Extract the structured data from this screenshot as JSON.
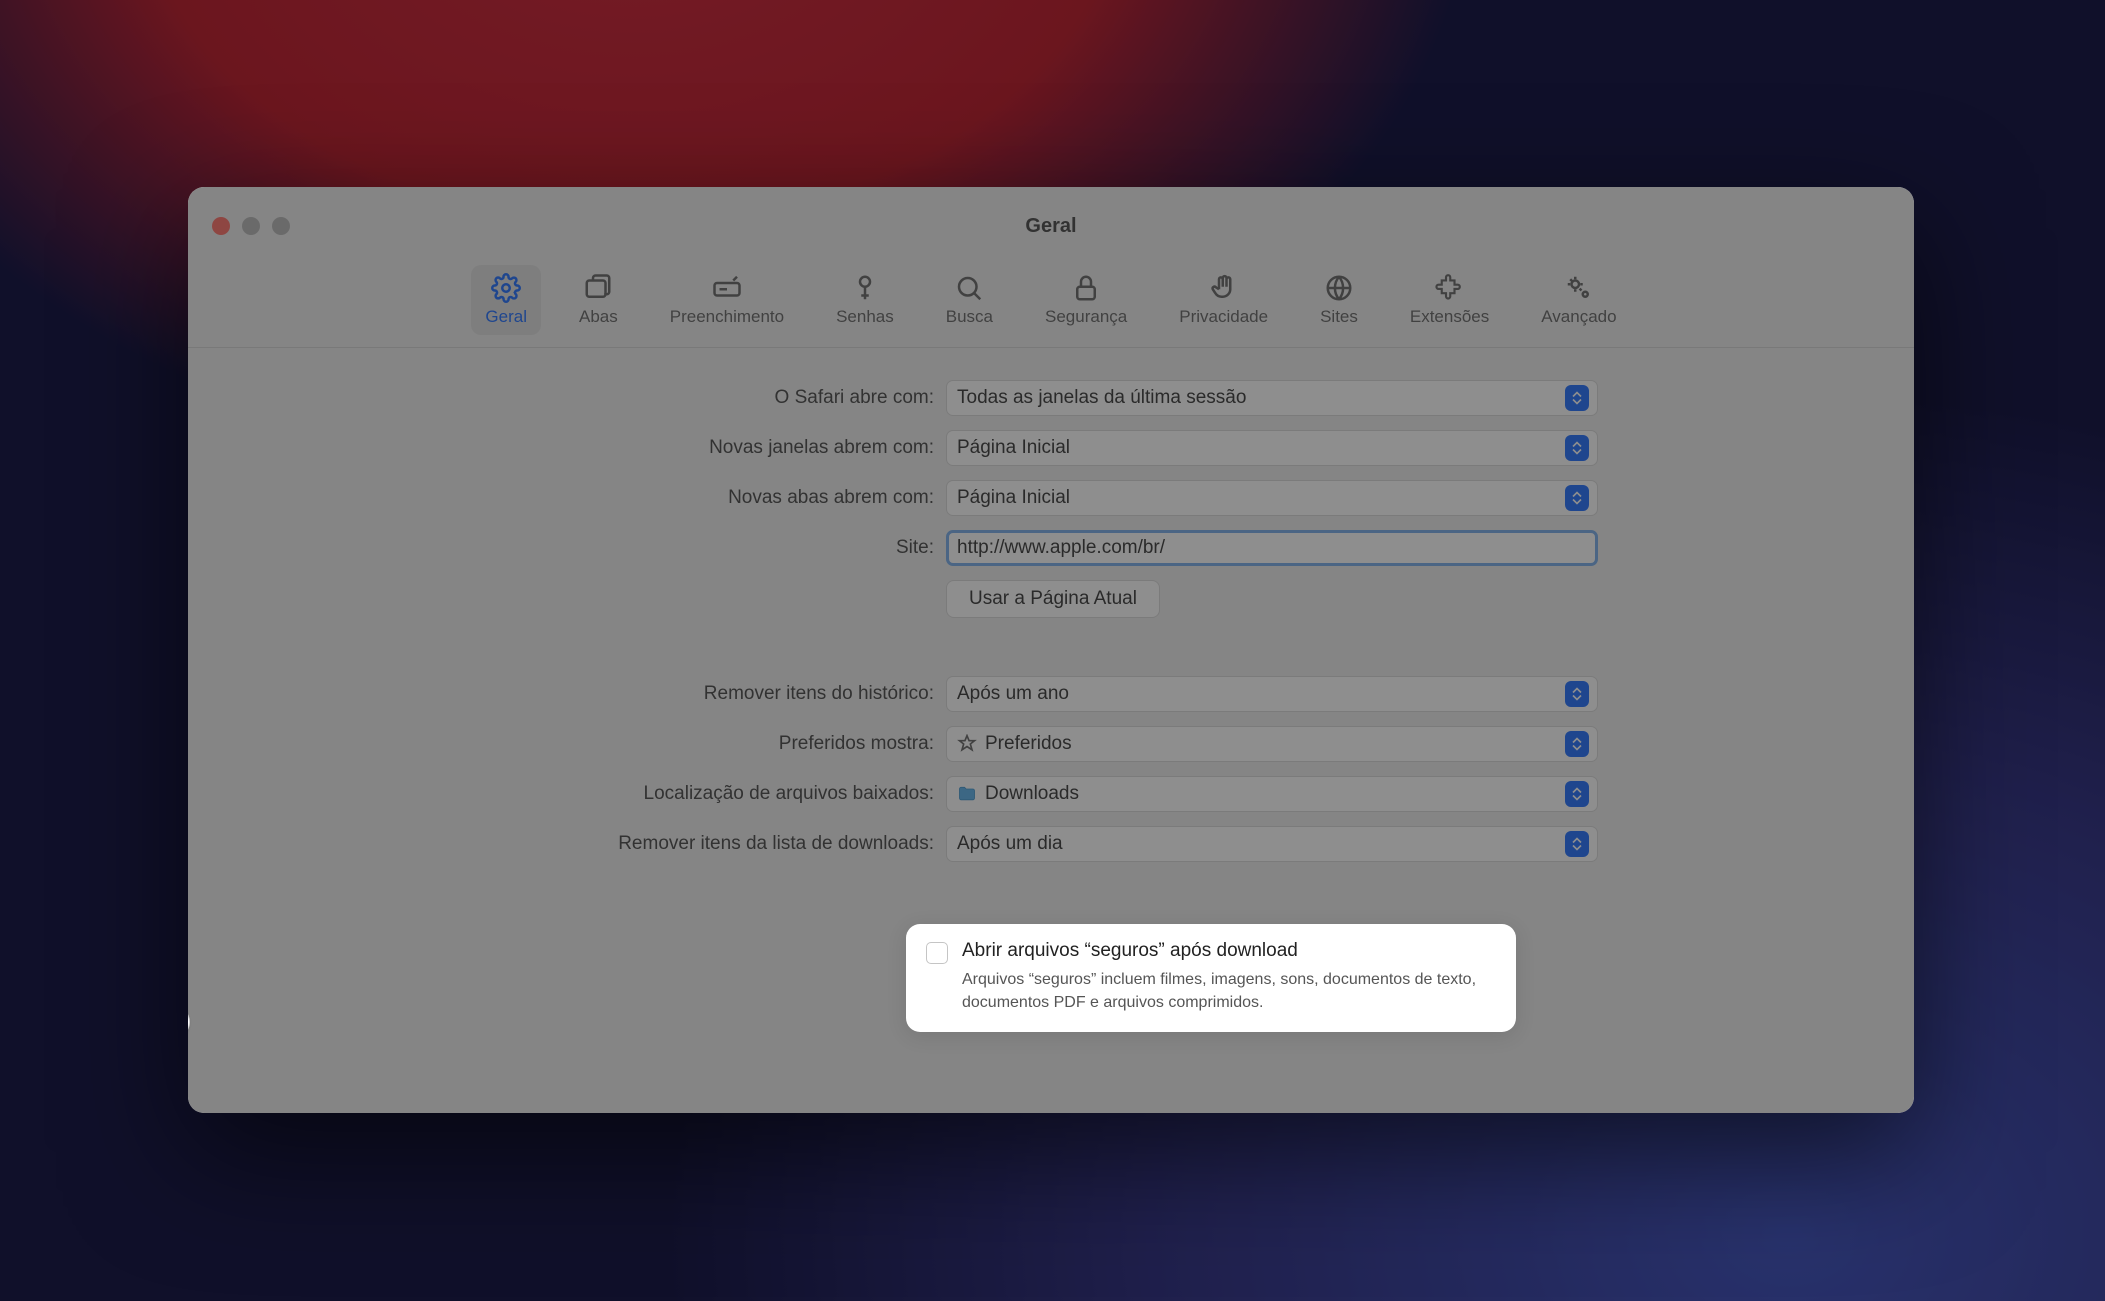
{
  "window": {
    "title": "Geral"
  },
  "tabs": [
    {
      "label": "Geral"
    },
    {
      "label": "Abas"
    },
    {
      "label": "Preenchimento"
    },
    {
      "label": "Senhas"
    },
    {
      "label": "Busca"
    },
    {
      "label": "Segurança"
    },
    {
      "label": "Privacidade"
    },
    {
      "label": "Sites"
    },
    {
      "label": "Extensões"
    },
    {
      "label": "Avançado"
    }
  ],
  "form": {
    "safari_opens_label": "O Safari abre com:",
    "safari_opens_value": "Todas as janelas da última sessão",
    "new_windows_label": "Novas janelas abrem com:",
    "new_windows_value": "Página Inicial",
    "new_tabs_label": "Novas abas abrem com:",
    "new_tabs_value": "Página Inicial",
    "site_label": "Site:",
    "site_value": "http://www.apple.com/br/",
    "use_current_page": "Usar a Página Atual",
    "remove_history_label": "Remover itens do histórico:",
    "remove_history_value": "Após um ano",
    "favorites_shows_label": "Preferidos mostra:",
    "favorites_shows_value": "Preferidos",
    "download_location_label": "Localização de arquivos baixados:",
    "download_location_value": "Downloads",
    "remove_downloads_label": "Remover itens da lista de downloads:",
    "remove_downloads_value": "Após um dia",
    "open_safe_label": "Abrir arquivos “seguros” após download",
    "open_safe_desc": "Arquivos “seguros” incluem filmes, imagens, sons, documentos de texto, documentos PDF e arquivos comprimidos.",
    "help": "?"
  }
}
